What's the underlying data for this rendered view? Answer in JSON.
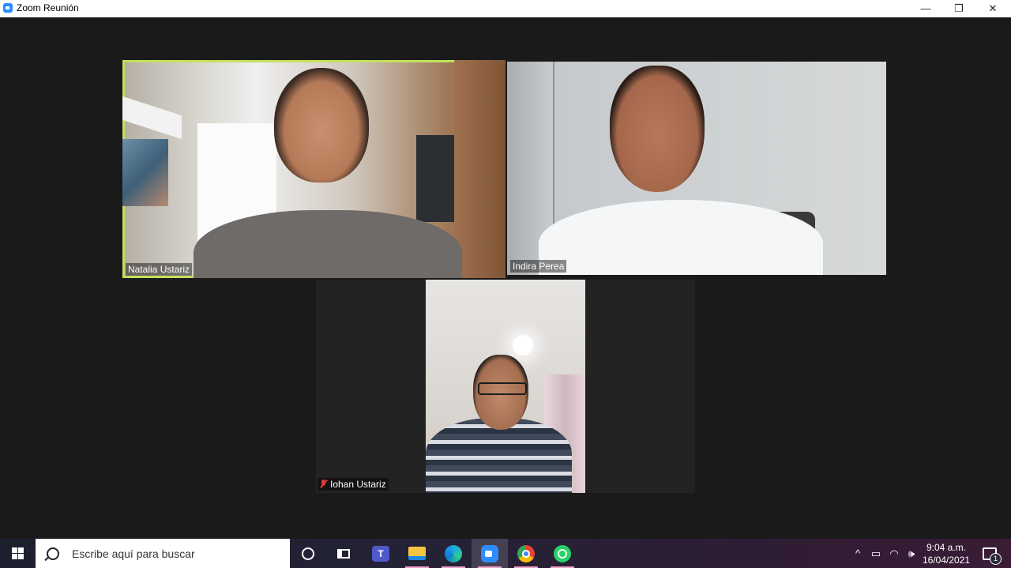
{
  "window": {
    "title": "Zoom Reunión",
    "minimize_glyph": "—",
    "restore_glyph": "❐",
    "close_glyph": "✕"
  },
  "participants": [
    {
      "name": "Natalia Ustariz",
      "active_speaker": true,
      "muted": false
    },
    {
      "name": "Indira Perea",
      "active_speaker": false,
      "muted": false
    },
    {
      "name": "Iohan Ustariz",
      "active_speaker": false,
      "muted": true
    }
  ],
  "taskbar": {
    "search_placeholder": "Escribe aquí para buscar",
    "teams_letter": "T",
    "apps": [
      "cortana-icon",
      "task-view-icon",
      "teams-icon",
      "file-explorer-icon",
      "edge-icon",
      "zoom-icon",
      "chrome-icon",
      "whatsapp-icon"
    ],
    "tray": {
      "chevron": "^",
      "battery": "▭",
      "wifi": "◠",
      "volume": "🕪",
      "time": "9:04 a.m.",
      "date": "16/04/2021",
      "notifications": "1"
    }
  },
  "colors": {
    "active_speaker_border": "#c3e05f",
    "zoom_blue": "#2d8cff",
    "muted_red": "#e03a3a"
  }
}
